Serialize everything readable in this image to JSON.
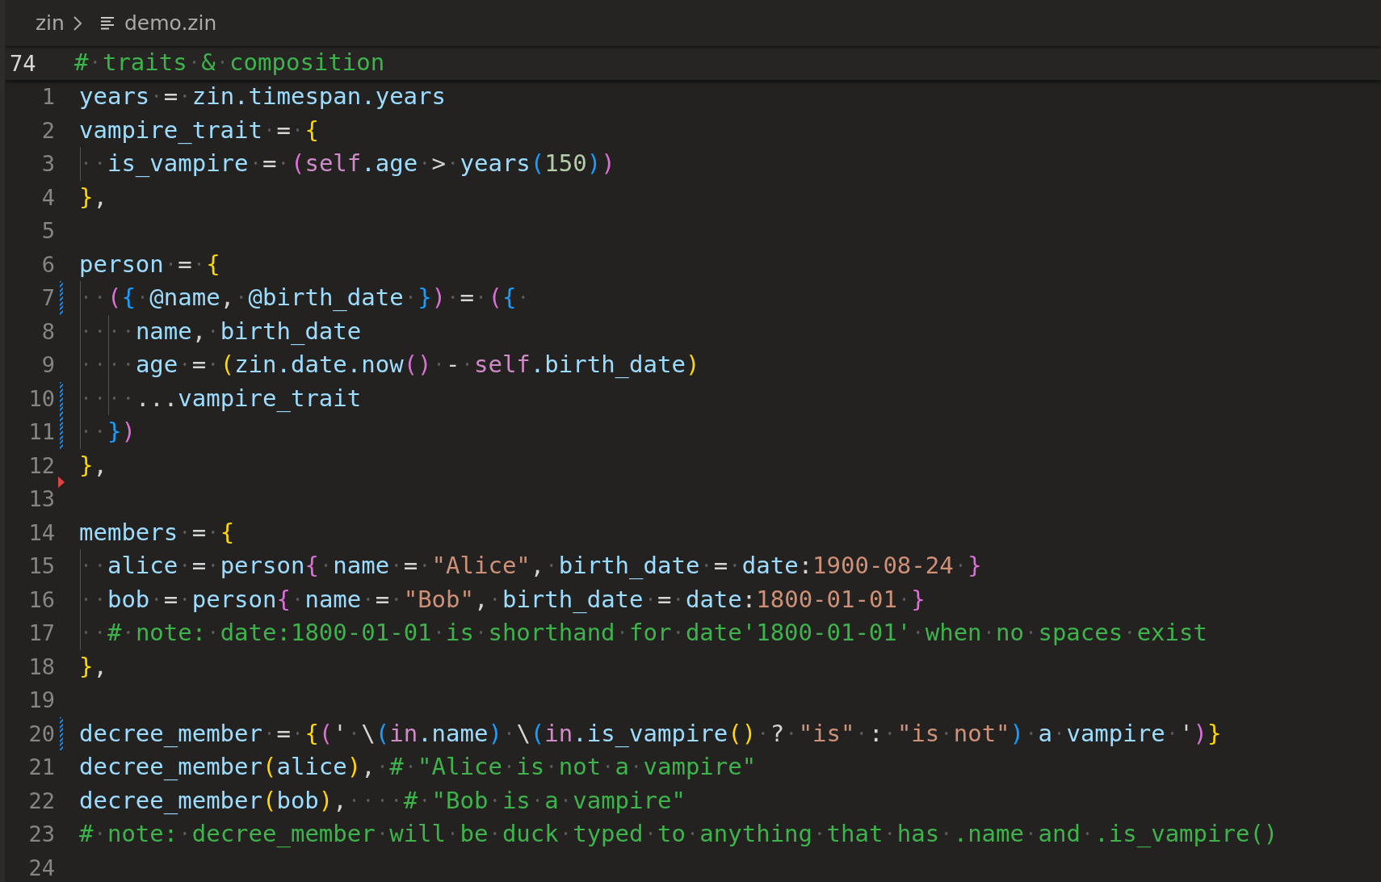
{
  "breadcrumb": {
    "folder": "zin",
    "file": "demo.zin"
  },
  "sticky_line": {
    "number": "74",
    "tokens": [
      {
        "kind": "comment",
        "text": "# traits & composition"
      }
    ]
  },
  "lines": [
    {
      "number": "1",
      "modified": false,
      "deleted": false,
      "tokens": [
        {
          "kind": "var",
          "text": "years"
        },
        {
          "kind": "op",
          "text": " = "
        },
        {
          "kind": "var",
          "text": "zin.timespan.years"
        }
      ]
    },
    {
      "number": "2",
      "modified": false,
      "deleted": false,
      "tokens": [
        {
          "kind": "var",
          "text": "vampire_trait"
        },
        {
          "kind": "op",
          "text": " = "
        },
        {
          "kind": "b1",
          "text": "{"
        }
      ]
    },
    {
      "number": "3",
      "modified": false,
      "deleted": false,
      "tokens": [
        {
          "kind": "var",
          "text": "  is_vampire"
        },
        {
          "kind": "op",
          "text": " = "
        },
        {
          "kind": "b2",
          "text": "("
        },
        {
          "kind": "kw",
          "text": "self"
        },
        {
          "kind": "var",
          "text": ".age"
        },
        {
          "kind": "op",
          "text": " > "
        },
        {
          "kind": "var",
          "text": "years"
        },
        {
          "kind": "b3",
          "text": "("
        },
        {
          "kind": "num",
          "text": "150"
        },
        {
          "kind": "b3",
          "text": ")"
        },
        {
          "kind": "b2",
          "text": ")"
        }
      ]
    },
    {
      "number": "4",
      "modified": false,
      "deleted": false,
      "tokens": [
        {
          "kind": "b1",
          "text": "}"
        },
        {
          "kind": "op",
          "text": ","
        }
      ]
    },
    {
      "number": "5",
      "modified": false,
      "deleted": false
    },
    {
      "number": "6",
      "modified": false,
      "deleted": false,
      "tokens": [
        {
          "kind": "var",
          "text": "person"
        },
        {
          "kind": "op",
          "text": " = "
        },
        {
          "kind": "b1",
          "text": "{"
        }
      ]
    },
    {
      "number": "7",
      "modified": true,
      "deleted": false,
      "tokens": [
        {
          "kind": "b2",
          "text": "  ("
        },
        {
          "kind": "b3",
          "text": "{"
        },
        {
          "kind": "var",
          "text": " @name"
        },
        {
          "kind": "op",
          "text": ", "
        },
        {
          "kind": "var",
          "text": "@birth_date "
        },
        {
          "kind": "b3",
          "text": "}"
        },
        {
          "kind": "b2",
          "text": ")"
        },
        {
          "kind": "op",
          "text": " = "
        },
        {
          "kind": "b2",
          "text": "("
        },
        {
          "kind": "b3",
          "text": "{ "
        }
      ]
    },
    {
      "number": "8",
      "modified": false,
      "deleted": false,
      "tokens": [
        {
          "kind": "var",
          "text": "    name"
        },
        {
          "kind": "op",
          "text": ", "
        },
        {
          "kind": "var",
          "text": "birth_date"
        }
      ]
    },
    {
      "number": "9",
      "modified": false,
      "deleted": false,
      "tokens": [
        {
          "kind": "var",
          "text": "    age"
        },
        {
          "kind": "op",
          "text": " = "
        },
        {
          "kind": "b1",
          "text": "("
        },
        {
          "kind": "var",
          "text": "zin.date.now"
        },
        {
          "kind": "b2",
          "text": "()"
        },
        {
          "kind": "op",
          "text": " - "
        },
        {
          "kind": "kw",
          "text": "self"
        },
        {
          "kind": "var",
          "text": ".birth_date"
        },
        {
          "kind": "b1",
          "text": ")"
        }
      ]
    },
    {
      "number": "10",
      "modified": true,
      "deleted": false,
      "tokens": [
        {
          "kind": "op",
          "text": "    ..."
        },
        {
          "kind": "var",
          "text": "vampire_trait"
        }
      ]
    },
    {
      "number": "11",
      "modified": true,
      "deleted": false,
      "tokens": [
        {
          "kind": "b3",
          "text": "  }"
        },
        {
          "kind": "b2",
          "text": ")"
        }
      ]
    },
    {
      "number": "12",
      "modified": false,
      "deleted": false,
      "tokens": [
        {
          "kind": "b1",
          "text": "}"
        },
        {
          "kind": "op",
          "text": ","
        }
      ]
    },
    {
      "number": "13",
      "modified": false,
      "deleted": true
    },
    {
      "number": "14",
      "modified": false,
      "deleted": false,
      "tokens": [
        {
          "kind": "var",
          "text": "members"
        },
        {
          "kind": "op",
          "text": " = "
        },
        {
          "kind": "b1",
          "text": "{"
        }
      ]
    },
    {
      "number": "15",
      "modified": false,
      "deleted": false,
      "tokens": [
        {
          "kind": "var",
          "text": "  alice"
        },
        {
          "kind": "op",
          "text": " = "
        },
        {
          "kind": "var",
          "text": "person"
        },
        {
          "kind": "b2",
          "text": "{"
        },
        {
          "kind": "var",
          "text": " name"
        },
        {
          "kind": "op",
          "text": " = "
        },
        {
          "kind": "str",
          "text": "\"Alice\""
        },
        {
          "kind": "op",
          "text": ", "
        },
        {
          "kind": "var",
          "text": "birth_date"
        },
        {
          "kind": "op",
          "text": " = "
        },
        {
          "kind": "var",
          "text": "date"
        },
        {
          "kind": "op",
          "text": ":"
        },
        {
          "kind": "str",
          "text": "1900-08-24"
        },
        {
          "kind": "b2",
          "text": " }"
        }
      ]
    },
    {
      "number": "16",
      "modified": false,
      "deleted": false,
      "tokens": [
        {
          "kind": "var",
          "text": "  bob"
        },
        {
          "kind": "op",
          "text": " = "
        },
        {
          "kind": "var",
          "text": "person"
        },
        {
          "kind": "b2",
          "text": "{"
        },
        {
          "kind": "var",
          "text": " name"
        },
        {
          "kind": "op",
          "text": " = "
        },
        {
          "kind": "str",
          "text": "\"Bob\""
        },
        {
          "kind": "op",
          "text": ", "
        },
        {
          "kind": "var",
          "text": "birth_date"
        },
        {
          "kind": "op",
          "text": " = "
        },
        {
          "kind": "var",
          "text": "date"
        },
        {
          "kind": "op",
          "text": ":"
        },
        {
          "kind": "str",
          "text": "1800-01-01"
        },
        {
          "kind": "b2",
          "text": " }"
        }
      ]
    },
    {
      "number": "17",
      "modified": false,
      "deleted": false,
      "tokens": [
        {
          "kind": "comment",
          "text": "  # note: date:1800-01-01 is shorthand for date'1800-01-01' when no spaces exist"
        }
      ]
    },
    {
      "number": "18",
      "modified": false,
      "deleted": false,
      "tokens": [
        {
          "kind": "b1",
          "text": "}"
        },
        {
          "kind": "op",
          "text": ","
        }
      ]
    },
    {
      "number": "19",
      "modified": false,
      "deleted": false
    },
    {
      "number": "20",
      "modified": true,
      "deleted": false,
      "tokens": [
        {
          "kind": "var",
          "text": "decree_member"
        },
        {
          "kind": "op",
          "text": " = "
        },
        {
          "kind": "b1",
          "text": "{"
        },
        {
          "kind": "b2",
          "text": "("
        },
        {
          "kind": "op",
          "text": "' \\"
        },
        {
          "kind": "b3",
          "text": "("
        },
        {
          "kind": "kw",
          "text": "in"
        },
        {
          "kind": "var",
          "text": ".name"
        },
        {
          "kind": "b3",
          "text": ")"
        },
        {
          "kind": "op",
          "text": " \\"
        },
        {
          "kind": "b3",
          "text": "("
        },
        {
          "kind": "kw",
          "text": "in"
        },
        {
          "kind": "var",
          "text": ".is_vampire"
        },
        {
          "kind": "b1",
          "text": "()"
        },
        {
          "kind": "op",
          "text": " ? "
        },
        {
          "kind": "str",
          "text": "\"is\""
        },
        {
          "kind": "op",
          "text": " : "
        },
        {
          "kind": "str",
          "text": "\"is not\""
        },
        {
          "kind": "b3",
          "text": ")"
        },
        {
          "kind": "var",
          "text": " a vampire "
        },
        {
          "kind": "op",
          "text": "'"
        },
        {
          "kind": "b2",
          "text": ")"
        },
        {
          "kind": "b1",
          "text": "}"
        }
      ]
    },
    {
      "number": "21",
      "modified": false,
      "deleted": false,
      "tokens": [
        {
          "kind": "var",
          "text": "decree_member"
        },
        {
          "kind": "b1",
          "text": "("
        },
        {
          "kind": "var",
          "text": "alice"
        },
        {
          "kind": "b1",
          "text": ")"
        },
        {
          "kind": "op",
          "text": ", "
        },
        {
          "kind": "comment",
          "text": "# \"Alice is not a vampire\""
        }
      ]
    },
    {
      "number": "22",
      "modified": false,
      "deleted": false,
      "tokens": [
        {
          "kind": "var",
          "text": "decree_member"
        },
        {
          "kind": "b1",
          "text": "("
        },
        {
          "kind": "var",
          "text": "bob"
        },
        {
          "kind": "b1",
          "text": ")"
        },
        {
          "kind": "op",
          "text": ",    "
        },
        {
          "kind": "comment",
          "text": "# \"Bob is a vampire\""
        }
      ]
    },
    {
      "number": "23",
      "modified": false,
      "deleted": false,
      "tokens": [
        {
          "kind": "comment",
          "text": "# note: decree_member will be duck typed to anything that has .name and .is_vampire()"
        }
      ]
    },
    {
      "number": "24",
      "modified": false,
      "deleted": false
    }
  ]
}
